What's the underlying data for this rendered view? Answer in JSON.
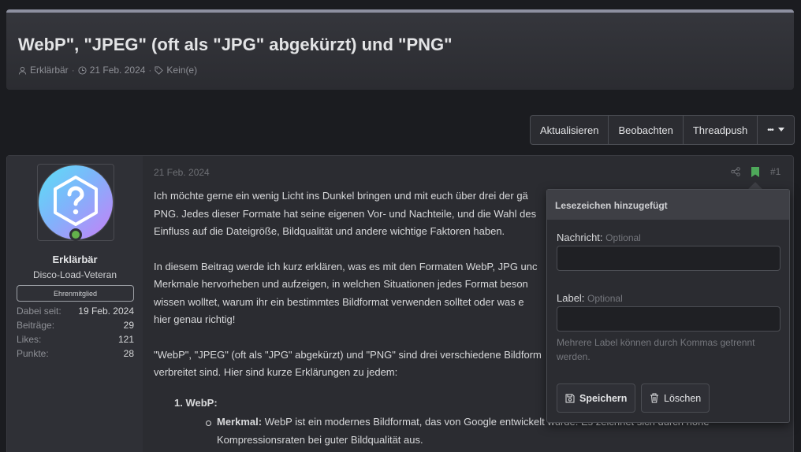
{
  "thread": {
    "title": "WebP\", \"JPEG\" (oft als \"JPG\" abgekürzt) und \"PNG\"",
    "author": "Erklärbär",
    "date": "21 Feb. 2024",
    "tags": "Kein(e)"
  },
  "actions": {
    "refresh": "Aktualisieren",
    "watch": "Beobachten",
    "threadpush": "Threadpush",
    "more": "•••"
  },
  "user": {
    "name": "Erklärbär",
    "title": "Disco-Load-Veteran",
    "banner": "Ehrenmitglied",
    "stats": [
      {
        "label": "Dabei seit:",
        "value": "19 Feb. 2024"
      },
      {
        "label": "Beiträge:",
        "value": "29"
      },
      {
        "label": "Likes:",
        "value": "121"
      },
      {
        "label": "Punkte:",
        "value": "28"
      }
    ]
  },
  "post": {
    "date": "21 Feb. 2024",
    "number": "#1",
    "p1": "Ich möchte gerne ein wenig Licht ins Dunkel bringen und mit euch über drei der gä PNG. Jedes dieser Formate hat seine eigenen Vor- und Nachteile, und die Wahl des Einfluss auf die Dateigröße, Bildqualität und andere wichtige Faktoren haben.",
    "p1_l1": "Ich möchte gerne ein wenig Licht ins Dunkel bringen und mit euch über drei der gä",
    "p1_l2": "PNG. Jedes dieser Formate hat seine eigenen Vor- und Nachteile, und die Wahl des",
    "p1_l3": "Einfluss auf die Dateigröße, Bildqualität und andere wichtige Faktoren haben.",
    "p2_l1": "In diesem Beitrag werde ich kurz erklären, was es mit den Formaten WebP, JPG unc",
    "p2_l2": "Merkmale hervorheben und aufzeigen, in welchen Situationen jedes Format beson",
    "p2_l3": "wissen wolltet, warum ihr ein bestimmtes Bildformat verwenden solltet oder was e",
    "p2_l4": "hier genau richtig!",
    "p3_l1": "\"WebP\", \"JPEG\" (oft als \"JPG\" abgekürzt) und \"PNG\" sind drei verschiedene Bildform",
    "p3_l2": "verbreitet sind. Hier sind kurze Erklärungen zu jedem:",
    "list_item": "1. WebP:",
    "sub_label": "Merkmal:",
    "sub_text_l1": " WebP ist ein modernes Bildformat, das von Google entwickelt wurde. Es zeichnet sich durch hohe",
    "sub_text_l2": "Kompressionsraten bei guter Bildqualität aus."
  },
  "bookmark_popup": {
    "title": "Lesezeichen hinzugefügt",
    "message_label": "Nachricht:",
    "message_optional": "Optional",
    "label_label": "Label:",
    "label_optional": "Optional",
    "hint": "Mehrere Label können durch Kommas getrennt werden.",
    "save": "Speichern",
    "delete": "Löschen"
  },
  "colors": {
    "bookmark_active": "#4ea85a",
    "online": "#63b14b"
  }
}
